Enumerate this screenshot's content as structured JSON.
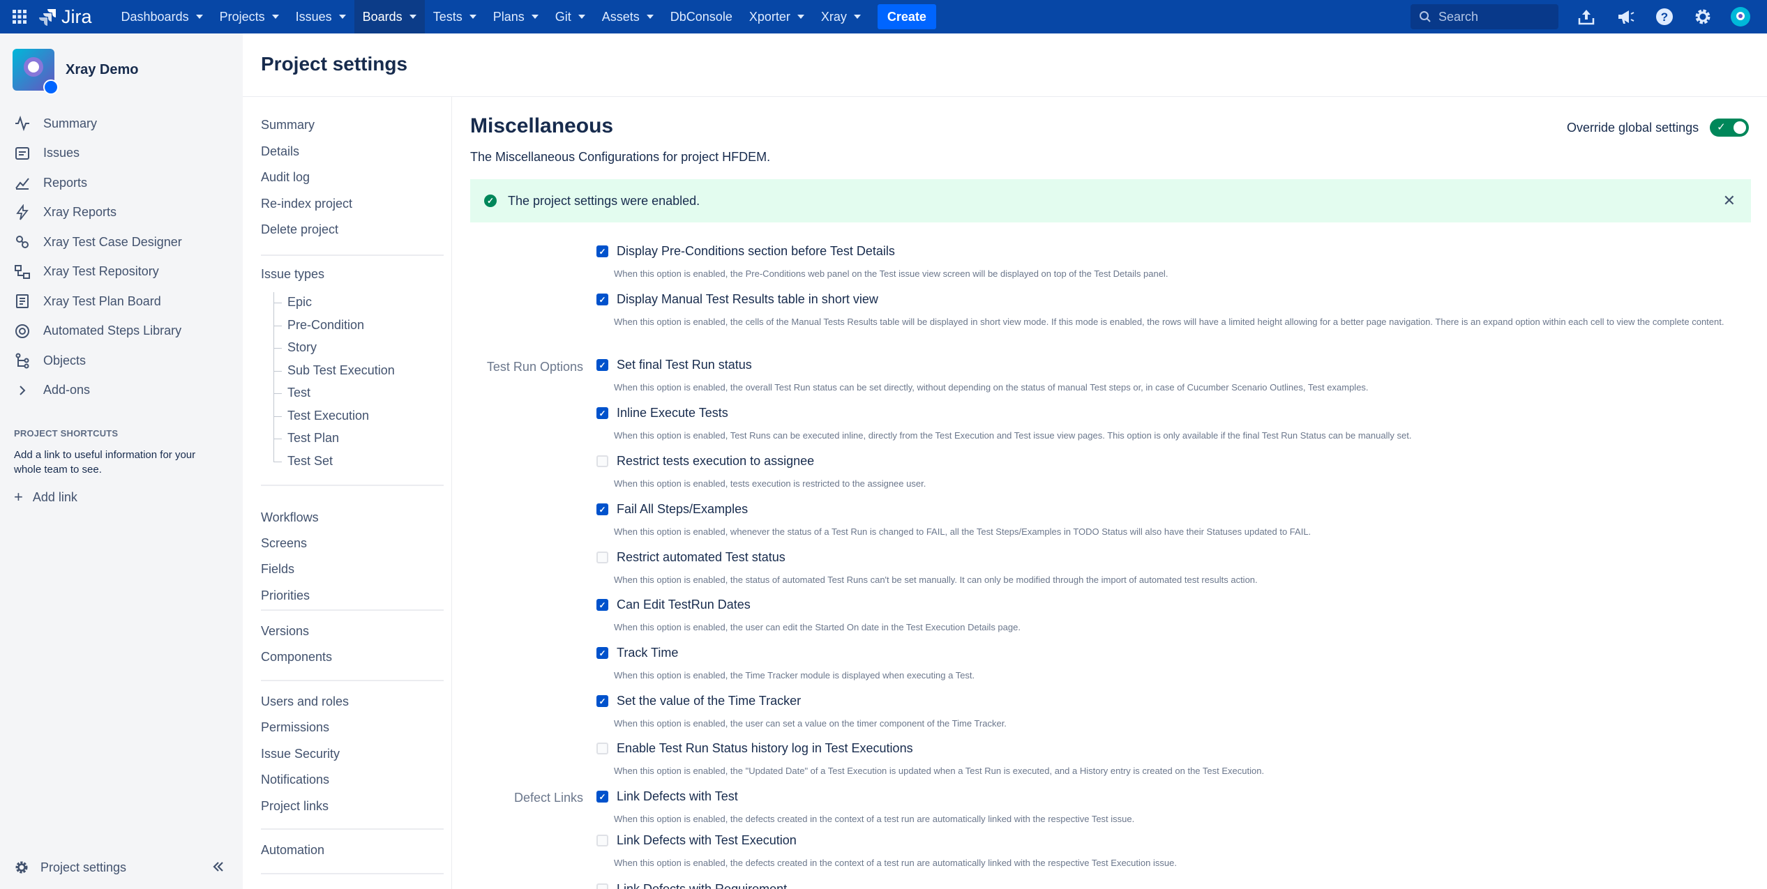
{
  "topnav": {
    "product": "Jira",
    "menu": [
      {
        "label": "Dashboards",
        "caret": true
      },
      {
        "label": "Projects",
        "caret": true
      },
      {
        "label": "Issues",
        "caret": true
      },
      {
        "label": "Boards",
        "caret": true,
        "active": true
      },
      {
        "label": "Tests",
        "caret": true
      },
      {
        "label": "Plans",
        "caret": true
      },
      {
        "label": "Git",
        "caret": true
      },
      {
        "label": "Assets",
        "caret": true
      },
      {
        "label": "DbConsole",
        "caret": false
      },
      {
        "label": "Xporter",
        "caret": true
      },
      {
        "label": "Xray",
        "caret": true
      }
    ],
    "create_label": "Create",
    "search_placeholder": "Search",
    "bg_color": "#0747a6"
  },
  "sidebar": {
    "project_name": "Xray Demo",
    "items": [
      {
        "label": "Summary",
        "icon": "activity-icon"
      },
      {
        "label": "Issues",
        "icon": "issues-icon"
      },
      {
        "label": "Reports",
        "icon": "chart-icon"
      },
      {
        "label": "Xray Reports",
        "icon": "lightning-icon"
      },
      {
        "label": "Xray Test Case Designer",
        "icon": "designer-icon"
      },
      {
        "label": "Xray Test Repository",
        "icon": "repository-icon"
      },
      {
        "label": "Xray Test Plan Board",
        "icon": "board-icon"
      },
      {
        "label": "Automated Steps Library",
        "icon": "library-icon"
      },
      {
        "label": "Objects",
        "icon": "objects-icon"
      },
      {
        "label": "Add-ons",
        "icon": "chevron-right-icon"
      }
    ],
    "shortcuts_title": "PROJECT SHORTCUTS",
    "shortcuts_text": "Add a link to useful information for your whole team to see.",
    "add_link_label": "Add link",
    "footer_label": "Project settings"
  },
  "page": {
    "title": "Project settings"
  },
  "subnav": {
    "general": [
      "Summary",
      "Details",
      "Audit log",
      "Re-index project",
      "Delete project"
    ],
    "issue_types_label": "Issue types",
    "issue_types": [
      "Epic",
      "Pre-Condition",
      "Story",
      "Sub Test Execution",
      "Test",
      "Test Execution",
      "Test Plan",
      "Test Set"
    ],
    "group2": [
      "Workflows",
      "Screens",
      "Fields",
      "Priorities"
    ],
    "group3": [
      "Versions",
      "Components"
    ],
    "group4": [
      "Users and roles",
      "Permissions",
      "Issue Security",
      "Notifications",
      "Project links"
    ],
    "group5": [
      "Automation"
    ]
  },
  "main": {
    "title": "Miscellaneous",
    "description": "The Miscellaneous Configurations for project HFDEM.",
    "override_label": "Override global settings",
    "override_enabled": true,
    "banner_text": "The project settings were enabled.",
    "group_labels": {
      "test_run": "Test Run Options",
      "defect_links": "Defect Links"
    },
    "options": [
      {
        "label": "Display Pre-Conditions section before Test Details",
        "checked": true,
        "desc": "When this option is enabled, the Pre-Conditions web panel on the Test issue view screen will be displayed on top of the Test Details panel."
      },
      {
        "label": "Display Manual Test Results table in short view",
        "checked": true,
        "desc": "When this option is enabled, the cells of the Manual Tests Results table will be displayed in short view mode. If this mode is enabled, the rows will have a limited height allowing for a better page navigation. There is an expand option within each cell to view the complete content."
      },
      {
        "label": "Set final Test Run status",
        "checked": true,
        "desc": "When this option is enabled, the overall Test Run status can be set directly, without depending on the status of manual Test steps or, in case of Cucumber Scenario Outlines, Test examples."
      },
      {
        "label": "Inline Execute Tests",
        "checked": true,
        "desc": "When this option is enabled, Test Runs can be executed inline, directly from the Test Execution and Test issue view pages. This option is only available if the final Test Run Status can be manually set."
      },
      {
        "label": "Restrict tests execution to assignee",
        "checked": false,
        "desc": "When this option is enabled, tests execution is restricted to the assignee user."
      },
      {
        "label": "Fail All Steps/Examples",
        "checked": true,
        "desc": "When this option is enabled, whenever the status of a Test Run is changed to FAIL, all the Test Steps/Examples in TODO Status will also have their Statuses updated to FAIL."
      },
      {
        "label": "Restrict automated Test status",
        "checked": false,
        "desc": "When this option is enabled, the status of automated Test Runs can't be set manually. It can only be modified through the import of automated test results action."
      },
      {
        "label": "Can Edit TestRun Dates",
        "checked": true,
        "desc": "When this option is enabled, the user can edit the Started On date in the Test Execution Details page."
      },
      {
        "label": "Track Time",
        "checked": true,
        "desc": "When this option is enabled, the Time Tracker module is displayed when executing a Test."
      },
      {
        "label": "Set the value of the Time Tracker",
        "checked": true,
        "desc": "When this option is enabled, the user can set a value on the timer component of the Time Tracker."
      },
      {
        "label": "Enable Test Run Status history log in Test Executions",
        "checked": false,
        "desc": "When this option is enabled, the \"Updated Date\" of a Test Execution is updated when a Test Run is executed, and a History entry is created on the Test Execution."
      },
      {
        "label": "Link Defects with Test",
        "checked": true,
        "desc": "When this option is enabled, the defects created in the context of a test run are automatically linked with the respective Test issue."
      },
      {
        "label": "Link Defects with Test Execution",
        "checked": false,
        "desc": "When this option is enabled, the defects created in the context of a test run are automatically linked with the respective Test Execution issue."
      },
      {
        "label": "Link Defects with Requirement",
        "checked": false,
        "desc": ""
      }
    ]
  }
}
